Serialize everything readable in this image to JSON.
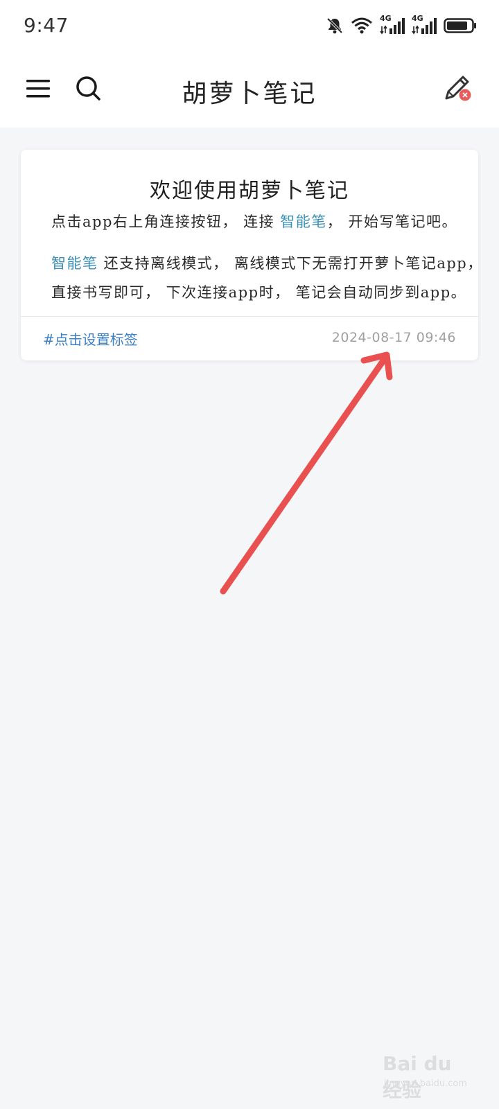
{
  "status_bar": {
    "time": "9:47",
    "icons": [
      "bell-muted-icon",
      "wifi-icon",
      "signal-4g-icon",
      "signal-4g-icon",
      "battery-icon"
    ],
    "network_label_1": "4G",
    "network_label_2": "4G"
  },
  "app_bar": {
    "title": "胡萝卜笔记",
    "menu_icon": "hamburger-menu-icon",
    "search_icon": "search-icon",
    "edit_icon": "pen-disconnected-icon",
    "edit_badge_color": "#e85c5c"
  },
  "note": {
    "title": "欢迎使用胡萝卜笔记",
    "line1_a": "点击app右上角连接按钮， 连接 ",
    "line1_hl": "智能笔",
    "line1_b": "， 开始写笔记吧。",
    "line2_hl": "智能笔",
    "line2_b": " 还支持离线模式， 离线模式下无需打开萝卜笔记app，",
    "line3": "直接书写即可， 下次连接app时， 笔记会自动同步到app。",
    "tag": "#点击设置标签",
    "date": "2024-08-17 09:46",
    "highlight_color": "#3a8fb7"
  },
  "annotation": {
    "arrow_color": "#e8514f"
  },
  "watermark": {
    "main": "Bai du 经验",
    "sub": "jingyan.baidu.com"
  }
}
